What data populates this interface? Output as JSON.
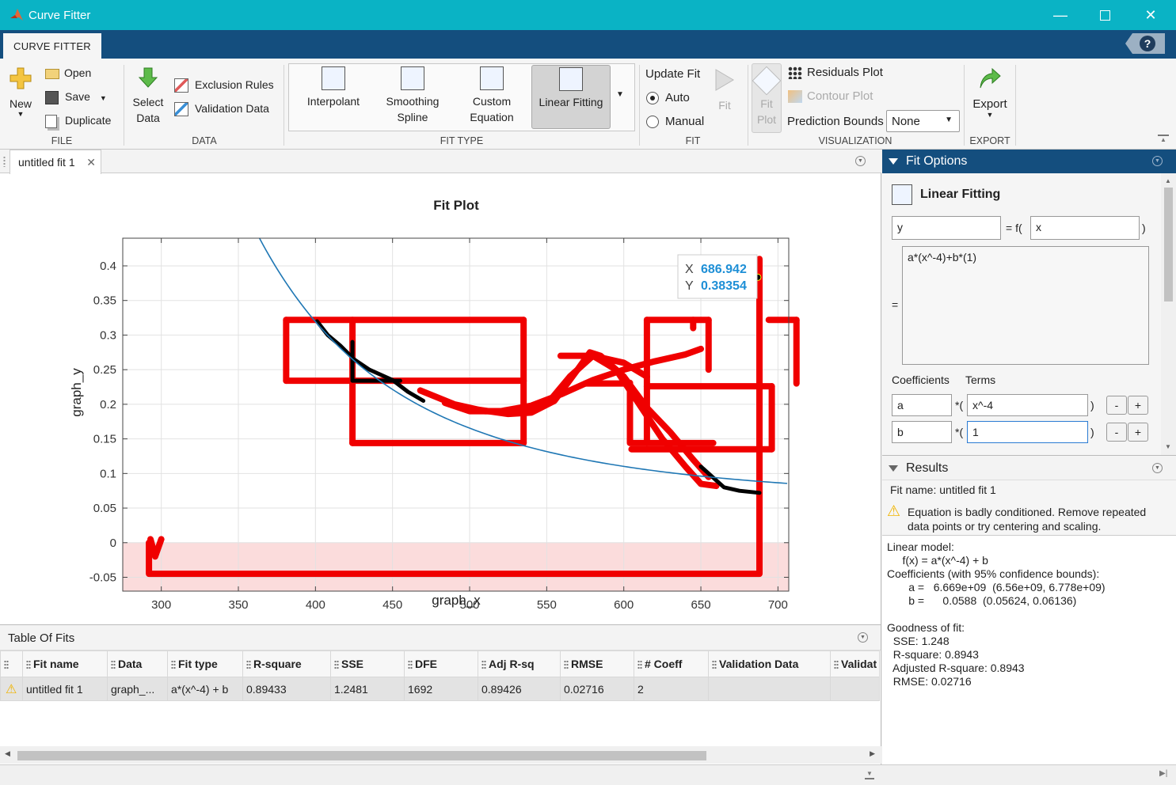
{
  "window": {
    "title": "Curve Fitter"
  },
  "ribbon": {
    "tab": "CURVE FITTER",
    "file": {
      "new": "New",
      "open": "Open",
      "save": "Save",
      "duplicate": "Duplicate",
      "group": "FILE"
    },
    "data": {
      "select_data_1": "Select",
      "select_data_2": "Data",
      "exclusion_rules": "Exclusion Rules",
      "validation_data": "Validation Data",
      "group": "DATA"
    },
    "fit_type": {
      "interpolant": "Interpolant",
      "smoothing_1": "Smoothing",
      "smoothing_2": "Spline",
      "custom_1": "Custom",
      "custom_2": "Equation",
      "linear_fitting": "Linear Fitting",
      "group": "FIT TYPE"
    },
    "fit": {
      "update_fit": "Update Fit",
      "auto": "Auto",
      "manual": "Manual",
      "fit_button": "Fit",
      "group": "FIT"
    },
    "visualization": {
      "fit_plot_1": "Fit",
      "fit_plot_2": "Plot",
      "residuals_plot": "Residuals Plot",
      "contour_plot": "Contour Plot",
      "prediction_bounds_label": "Prediction Bounds",
      "prediction_bounds_value": "None",
      "group": "VISUALIZATION"
    },
    "export": {
      "export": "Export",
      "group": "EXPORT"
    }
  },
  "document": {
    "tab": "untitled fit 1"
  },
  "chart_data": {
    "type": "scatter",
    "title": "Fit Plot",
    "xlabel": "graph_x",
    "ylabel": "graph_y",
    "xlim": [
      275,
      707
    ],
    "ylim": [
      -0.07,
      0.44
    ],
    "x_ticks": [
      300,
      350,
      400,
      450,
      500,
      550,
      600,
      650,
      700
    ],
    "y_ticks": [
      -0.05,
      0,
      0.05,
      0.1,
      0.15,
      0.2,
      0.25,
      0.3,
      0.35,
      0.4
    ],
    "y_tick_labels": [
      "-0.05",
      "0",
      "0.05",
      "0.1",
      "0.15",
      "0.2",
      "0.25",
      "0.3",
      "0.35",
      "0.4"
    ],
    "grid": true,
    "excluded_region": [
      -0.07,
      0
    ],
    "fit_curve": {
      "a": 6669000000.0,
      "b": 0.0588
    },
    "datatip": {
      "x_label": "X",
      "x_value": "686.942",
      "y_label": "Y",
      "y_value": "0.38354",
      "x": 686.942,
      "y": 0.38354
    },
    "excluded_paths": [
      [
        [
          292,
          0
        ],
        [
          292,
          -0.045
        ],
        [
          688,
          -0.045
        ],
        [
          688,
          0.41
        ]
      ],
      [
        [
          293,
          0.005
        ],
        [
          296,
          -0.02
        ],
        [
          300,
          0.005
        ]
      ],
      [
        [
          381,
          0.322
        ],
        [
          535,
          0.322
        ]
      ],
      [
        [
          381,
          0.234
        ],
        [
          535,
          0.234
        ]
      ],
      [
        [
          381,
          0.322
        ],
        [
          381,
          0.234
        ]
      ],
      [
        [
          424,
          0.322
        ],
        [
          424,
          0.144
        ]
      ],
      [
        [
          535,
          0.322
        ],
        [
          535,
          0.234
        ]
      ],
      [
        [
          424,
          0.144
        ],
        [
          535,
          0.144
        ]
      ],
      [
        [
          535,
          0.234
        ],
        [
          535,
          0.144
        ]
      ],
      [
        [
          468,
          0.22
        ],
        [
          490,
          0.2
        ],
        [
          510,
          0.19
        ],
        [
          530,
          0.19
        ],
        [
          550,
          0.2
        ],
        [
          565,
          0.24
        ],
        [
          580,
          0.27
        ],
        [
          595,
          0.25
        ],
        [
          610,
          0.2
        ],
        [
          625,
          0.15
        ],
        [
          640,
          0.11
        ],
        [
          650,
          0.085
        ],
        [
          660,
          0.082
        ]
      ],
      [
        [
          484,
          0.202
        ],
        [
          500,
          0.19
        ],
        [
          520,
          0.19
        ],
        [
          540,
          0.198
        ],
        [
          560,
          0.215
        ],
        [
          580,
          0.235
        ],
        [
          600,
          0.25
        ],
        [
          620,
          0.262
        ],
        [
          640,
          0.272
        ],
        [
          650,
          0.28
        ]
      ],
      [
        [
          506,
          0.192
        ],
        [
          525,
          0.186
        ],
        [
          540,
          0.188
        ],
        [
          555,
          0.205
        ],
        [
          570,
          0.25
        ],
        [
          578,
          0.275
        ],
        [
          585,
          0.27
        ],
        [
          600,
          0.24
        ],
        [
          615,
          0.195
        ],
        [
          630,
          0.16
        ],
        [
          645,
          0.12
        ],
        [
          655,
          0.095
        ]
      ],
      [
        [
          559,
          0.27
        ],
        [
          580,
          0.27
        ],
        [
          600,
          0.26
        ],
        [
          615,
          0.24
        ]
      ],
      [
        [
          604,
          0.231
        ],
        [
          604,
          0.144
        ],
        [
          658,
          0.144
        ]
      ],
      [
        [
          615,
          0.322
        ],
        [
          615,
          0.144
        ]
      ],
      [
        [
          615,
          0.322
        ],
        [
          655,
          0.322
        ]
      ],
      [
        [
          655,
          0.322
        ],
        [
          655,
          0.25
        ]
      ],
      [
        [
          615,
          0.226
        ],
        [
          696,
          0.226
        ]
      ],
      [
        [
          696,
          0.226
        ],
        [
          696,
          0.135
        ]
      ],
      [
        [
          605,
          0.135
        ],
        [
          696,
          0.135
        ]
      ],
      [
        [
          645,
          0.31
        ],
        [
          645,
          0.322
        ]
      ],
      [
        [
          694,
          0.322
        ],
        [
          712,
          0.322
        ]
      ],
      [
        [
          712,
          0.322
        ],
        [
          712,
          0.23
        ]
      ],
      [
        [
          575,
          0.23
        ],
        [
          603,
          0.23
        ]
      ]
    ],
    "data_paths": [
      [
        [
          401,
          0.32
        ],
        [
          408,
          0.3
        ],
        [
          416,
          0.285
        ],
        [
          425,
          0.265
        ],
        [
          435,
          0.25
        ],
        [
          450,
          0.235
        ],
        [
          460,
          0.218
        ],
        [
          470,
          0.205
        ]
      ],
      [
        [
          424,
          0.29
        ],
        [
          424,
          0.234
        ]
      ],
      [
        [
          424,
          0.234
        ],
        [
          455,
          0.234
        ]
      ],
      [
        [
          650,
          0.11
        ],
        [
          660,
          0.09
        ],
        [
          665,
          0.08
        ],
        [
          675,
          0.075
        ],
        [
          688,
          0.072
        ]
      ]
    ]
  },
  "table_of_fits": {
    "title": "Table Of Fits",
    "columns": [
      "Fit name",
      "Data",
      "Fit type",
      "R-square",
      "SSE",
      "DFE",
      "Adj R-sq",
      "RMSE",
      "# Coeff",
      "Validation Data",
      "Validat"
    ],
    "rows": [
      [
        "untitled fit 1",
        "graph_...",
        "a*(x^-4) + b",
        "0.89433",
        "1.2481",
        "1692",
        "0.89426",
        "0.02716",
        "2",
        "",
        ""
      ]
    ]
  },
  "fit_options": {
    "title": "Fit Options",
    "method": "Linear Fitting",
    "y_field": "y",
    "eq_sign": "= f(",
    "x_field": "x",
    "close_paren": ")",
    "equation": "a*(x^-4)+b*(1)",
    "equals": "=",
    "coefficients_label": "Coefficients",
    "terms_label": "Terms",
    "coeffs": [
      {
        "name": "a",
        "term": "x^-4"
      },
      {
        "name": "b",
        "term": "1"
      }
    ],
    "times_open": "*(",
    "minus": "-",
    "plus": "+"
  },
  "results": {
    "title": "Results",
    "fit_name": "Fit name: untitled fit 1",
    "warning_1": "Equation is badly conditioned. Remove repeated",
    "warning_2": "data points or try centering and scaling.",
    "model": "Linear model:\n     f(x) = a*(x^-4) + b\nCoefficients (with 95% confidence bounds):\n       a =   6.669e+09  (6.56e+09, 6.778e+09)\n       b =      0.0588  (0.05624, 0.06136)\n\nGoodness of fit:\n  SSE: 1.248\n  R-square: 0.8943\n  Adjusted R-square: 0.8943\n  RMSE: 0.02716"
  }
}
